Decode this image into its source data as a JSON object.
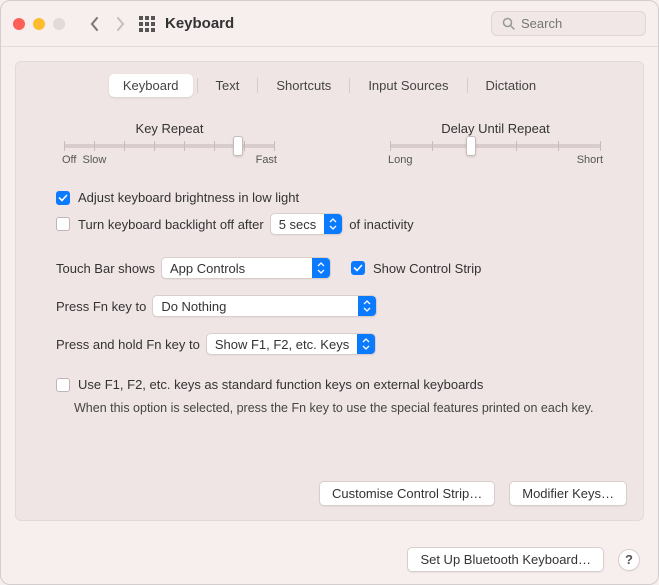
{
  "window": {
    "title": "Keyboard"
  },
  "search": {
    "placeholder": "Search"
  },
  "tabs": [
    "Keyboard",
    "Text",
    "Shortcuts",
    "Input Sources",
    "Dictation"
  ],
  "sliders": {
    "key_repeat": {
      "label": "Key Repeat",
      "off": "Off",
      "min": "Slow",
      "max": "Fast"
    },
    "delay": {
      "label": "Delay Until Repeat",
      "min": "Long",
      "max": "Short"
    }
  },
  "options": {
    "adjust_brightness": "Adjust keyboard brightness in low light",
    "backlight_off_prefix": "Turn keyboard backlight off after",
    "backlight_off_value": "5 secs",
    "backlight_off_suffix": "of inactivity",
    "touchbar_label": "Touch Bar shows",
    "touchbar_value": "App Controls",
    "show_control_strip": "Show Control Strip",
    "fn_press_label": "Press Fn key to",
    "fn_press_value": "Do Nothing",
    "fn_hold_label": "Press and hold Fn key to",
    "fn_hold_value": "Show F1, F2, etc. Keys",
    "use_fkeys": "Use F1, F2, etc. keys as standard function keys on external keyboards",
    "use_fkeys_help": "When this option is selected, press the Fn key to use the special features printed on each key."
  },
  "buttons": {
    "customise": "Customise Control Strip…",
    "modifier": "Modifier Keys…",
    "bluetooth": "Set Up Bluetooth Keyboard…",
    "help": "?"
  }
}
